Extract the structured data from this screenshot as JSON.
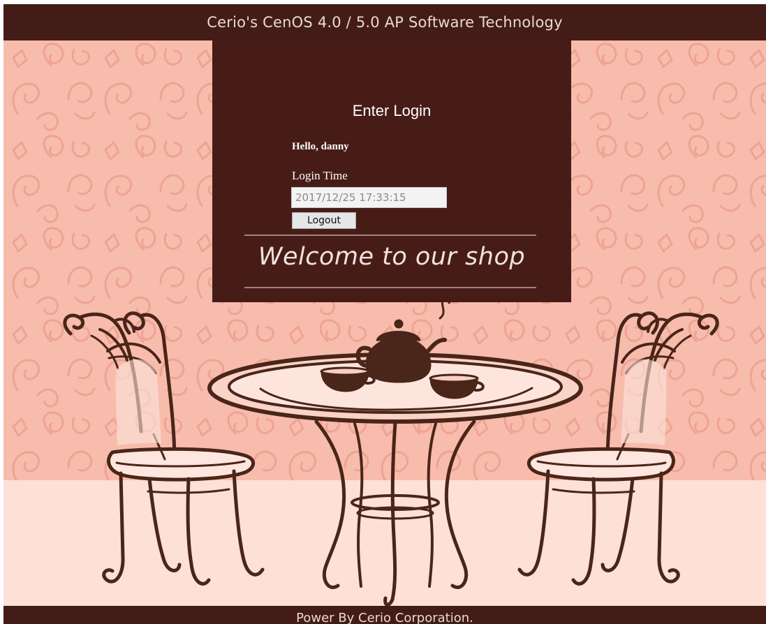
{
  "header": {
    "title": "Cerio's CenOS 4.0 / 5.0 AP Software Technology"
  },
  "login": {
    "heading": "Enter Login",
    "greeting": "Hello, danny",
    "login_time_label": "Login Time",
    "login_time_value": "2017/12/25 17:33:15",
    "logout_label": "Logout"
  },
  "banner": {
    "welcome": "Welcome to our shop"
  },
  "footer": {
    "text": "Power By Cerio Corporation."
  },
  "colors": {
    "dark_brown": "#431c17",
    "wallpaper": "#f7bcac",
    "floor": "#fde0d6",
    "pattern": "#f0a795"
  },
  "scene": {
    "illustration": "cafe-table-with-chairs-and-teapot"
  }
}
